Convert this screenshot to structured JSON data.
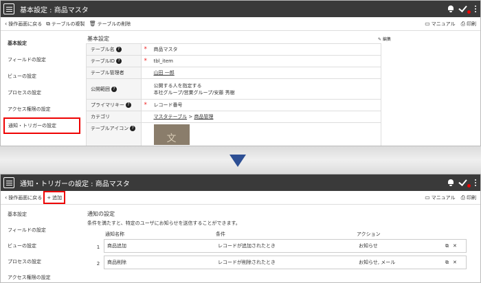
{
  "screen1": {
    "title": "基本設定 : 商品マスタ",
    "toolbar": {
      "back": "操作画面に戻る",
      "copy": "テーブルの複製",
      "delete": "テーブルの削除",
      "manual": "マニュアル",
      "print": "印刷"
    },
    "sidebar": [
      {
        "label": "基本設定"
      },
      {
        "label": "フィールドの設定"
      },
      {
        "label": "ビューの設定"
      },
      {
        "label": "プロセスの設定"
      },
      {
        "label": "アクセス権限の設定"
      },
      {
        "label": "通知・トリガーの設定"
      }
    ],
    "section_title": "基本設定",
    "edit_label": "編集",
    "rows": {
      "table_name": {
        "label": "テーブル名",
        "value": "商品マスタ"
      },
      "table_id": {
        "label": "テーブルID",
        "value": "tbl_item"
      },
      "manager": {
        "label": "テーブル管理者",
        "value": "山田 一郎"
      },
      "scope": {
        "label": "公開範囲",
        "value1": "公開する人を指定する",
        "value2": "本社グループ/営業グループ/安藤 秀樹"
      },
      "primary_key": {
        "label": "プライマリキー",
        "value": "レコード番号"
      },
      "category": {
        "label": "カテゴリ",
        "link1": "マスタテーブル",
        "sep": ">",
        "link2": "商品管理"
      },
      "icon": {
        "label": "テーブルアイコン",
        "glyph": "文"
      }
    }
  },
  "screen2": {
    "title": "通知・トリガーの設定 : 商品マスタ",
    "toolbar": {
      "back": "操作画面に戻る",
      "add": "追加",
      "manual": "マニュアル",
      "print": "印刷"
    },
    "sidebar": [
      {
        "label": "基本設定"
      },
      {
        "label": "フィールドの設定"
      },
      {
        "label": "ビューの設定"
      },
      {
        "label": "プロセスの設定"
      },
      {
        "label": "アクセス権限の設定"
      }
    ],
    "section_title": "通知の設定",
    "description": "条件を満たすと、特定のユーザにお知らせを送信することができます。",
    "columns": {
      "name": "通知名称",
      "cond": "条件",
      "action": "アクション"
    },
    "notices": [
      {
        "idx": "1",
        "name": "商品追加",
        "cond": "レコードが追加されたとき",
        "action": "お知らせ"
      },
      {
        "idx": "2",
        "name": "商品削除",
        "cond": "レコードが削除されたとき",
        "action": "お知らせ, メール"
      }
    ]
  },
  "colors": {
    "titlebar": "#3a3a3a",
    "highlight": "#ee0000",
    "arrow": "#2d4f94",
    "required": "#ee2222"
  }
}
